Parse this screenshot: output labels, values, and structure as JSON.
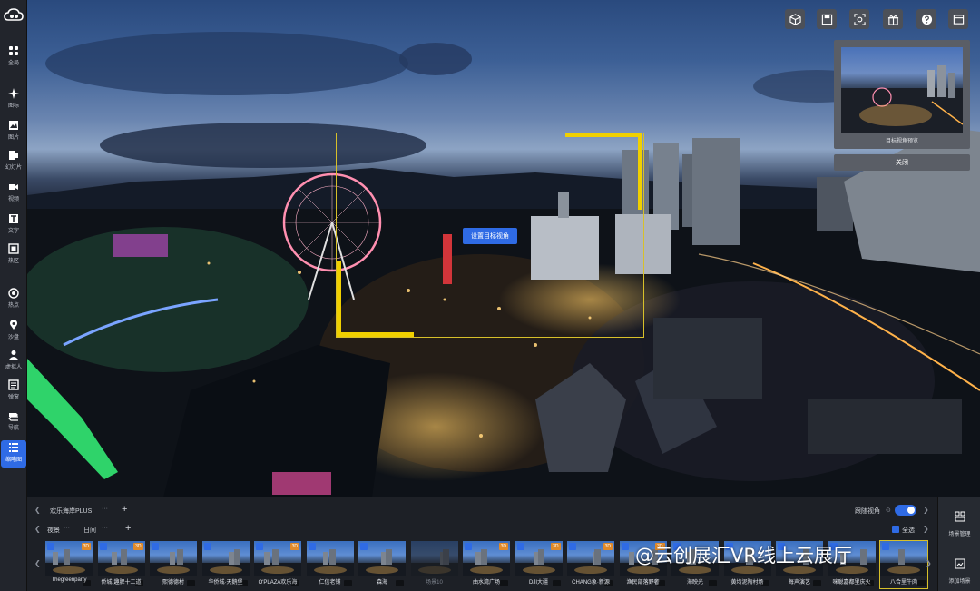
{
  "sidebar": {
    "items": [
      {
        "label": "全局",
        "icon": "grid-icon"
      },
      {
        "label": "图标",
        "icon": "sparkle-icon"
      },
      {
        "label": "图片",
        "icon": "image-icon"
      },
      {
        "label": "幻灯片",
        "icon": "slides-icon"
      },
      {
        "label": "视频",
        "icon": "video-icon"
      },
      {
        "label": "文字",
        "icon": "text-icon"
      },
      {
        "label": "热区",
        "icon": "hotzone-icon"
      },
      {
        "label": "热点",
        "icon": "hotspot-icon"
      },
      {
        "label": "沙盘",
        "icon": "pin-icon"
      },
      {
        "label": "虚拟人",
        "icon": "person-icon"
      },
      {
        "label": "弹窗",
        "icon": "popup-icon"
      },
      {
        "label": "导航",
        "icon": "nav-icon"
      },
      {
        "label": "缩略图",
        "icon": "list-icon"
      }
    ],
    "active_index": 12
  },
  "toolbar": {
    "buttons": [
      "cube-icon",
      "save-icon",
      "view-icon",
      "gift-icon",
      "help-icon",
      "window-icon"
    ]
  },
  "target": {
    "button_label": "设置目标视角"
  },
  "preview": {
    "caption": "目标视角预览",
    "close_label": "关闭"
  },
  "bottom": {
    "group_name": "欢乐海岸PLUS",
    "group_more": "···",
    "add_group": "+",
    "sub_tabs": [
      {
        "label": "夜景",
        "more": "···"
      },
      {
        "label": "日间",
        "more": "···"
      }
    ],
    "add_sub": "+",
    "follow_label": "跟随视角",
    "select_all_label": "全选"
  },
  "scenes": [
    {
      "label": "Thegreenparty",
      "badge": "3D"
    },
    {
      "label": "侨城·趣脾十二道",
      "badge": "3D"
    },
    {
      "label": "熙德德村",
      "badge": ""
    },
    {
      "label": "华侨城·天鹅堡",
      "badge": ""
    },
    {
      "label": "OʹPLAZA欢乐海",
      "badge": "3D"
    },
    {
      "label": "仁信老铺",
      "badge": ""
    },
    {
      "label": "森海",
      "badge": ""
    },
    {
      "label": "场景10",
      "badge": "",
      "dim": true
    },
    {
      "label": "曲水湾广场",
      "badge": "3D"
    },
    {
      "label": "DJI大疆",
      "badge": "3D"
    },
    {
      "label": "CHANG象·新源",
      "badge": "3D"
    },
    {
      "label": "渔民部落野奢",
      "badge": "3D"
    },
    {
      "label": "海映光",
      "badge": ""
    },
    {
      "label": "黄均泥陶村场",
      "badge": ""
    },
    {
      "label": "每声演艺",
      "badge": ""
    },
    {
      "label": "咪聪嘉都里庆火",
      "badge": ""
    },
    {
      "label": "八合里牛肉",
      "badge": "",
      "selected": true
    }
  ],
  "right_panel": {
    "scene_manage": "场景管理",
    "add_scene": "添加场景"
  },
  "watermark": {
    "text": "@云创展汇VR线上云展厅"
  },
  "colors": {
    "accent": "#2f6be5",
    "frame": "#f0d000",
    "badge": "#e08a2a"
  }
}
